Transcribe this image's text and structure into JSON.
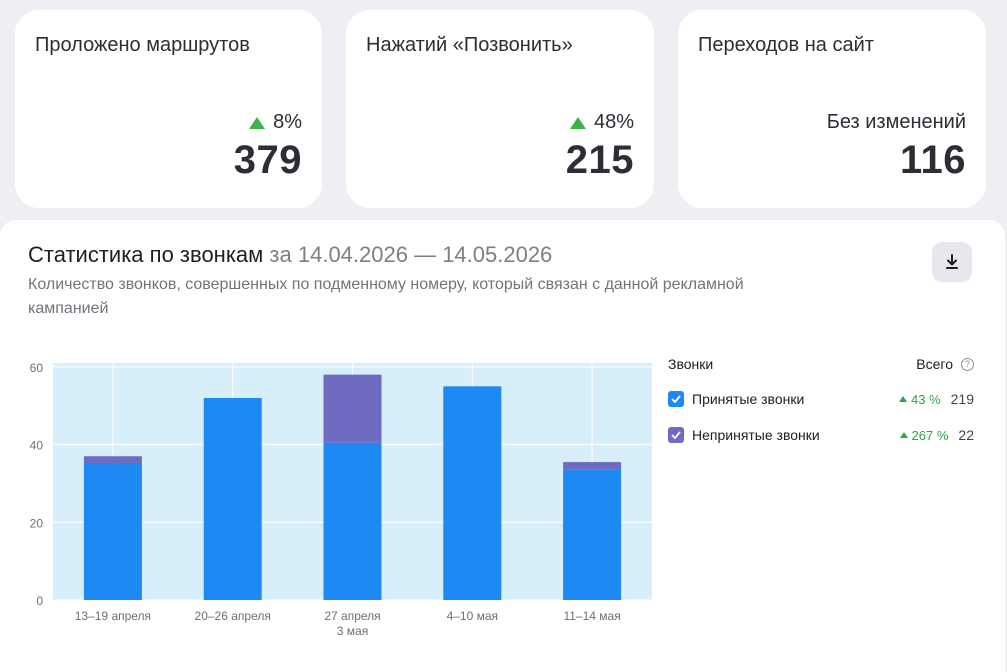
{
  "cards": [
    {
      "title": "Проложено маршрутов",
      "change": "8%",
      "value": "379"
    },
    {
      "title": "Нажатий «Позвонить»",
      "change": "48%",
      "value": "215"
    },
    {
      "title": "Переходов на сайт",
      "change": "Без изменений",
      "value": "116"
    }
  ],
  "stats": {
    "title": "Статистика по звонкам",
    "period": "за 14.04.2026 — 14.05.2026",
    "description": "Количество звонков, совершенных по подменному номеру, который связан с данной рекламной кампанией",
    "download_icon": "download-icon"
  },
  "legend": {
    "header": "Звонки",
    "total_label": "Всего",
    "help_icon": "?",
    "items": [
      {
        "label": "Принятые звонки",
        "change": "43 %",
        "total": "219",
        "color": "#1e88f3"
      },
      {
        "label": "Непринятые звонки",
        "change": "267 %",
        "total": "22",
        "color": "#6f6bc3"
      }
    ]
  },
  "chart_data": {
    "type": "bar",
    "stacked": true,
    "categories": [
      "13–19 апреля",
      "20–26 апреля",
      "27 апреля\n3 мая",
      "4–10 мая",
      "11–14 мая"
    ],
    "series": [
      {
        "name": "Принятые звонки",
        "values": [
          35,
          52,
          40.5,
          55,
          33.5
        ],
        "color": "#1e88f3"
      },
      {
        "name": "Непринятые звонки",
        "values": [
          2,
          0,
          17.5,
          0,
          2
        ],
        "color": "#6f6bc3"
      }
    ],
    "yticks": [
      0,
      20,
      40,
      60
    ],
    "ylim": [
      0,
      61
    ],
    "grid": true,
    "background": "#d6effa"
  }
}
